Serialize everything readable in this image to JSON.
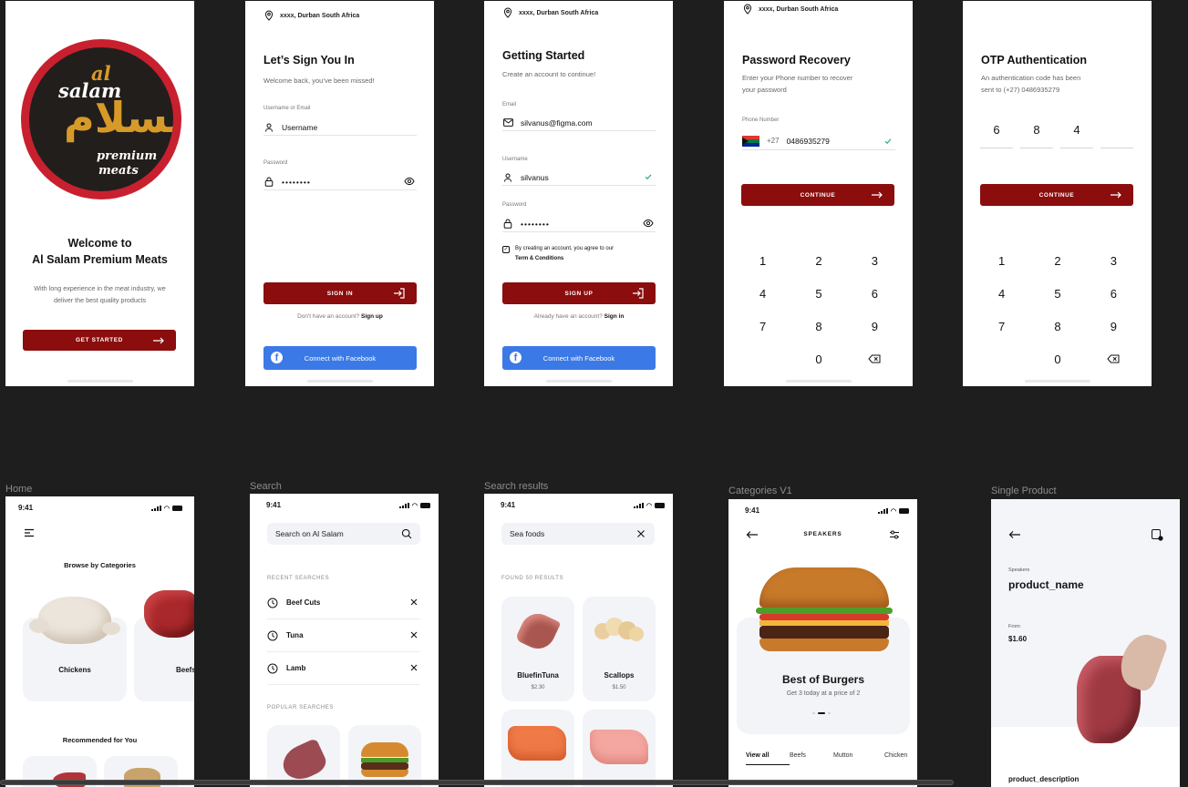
{
  "location": "xxxx, Durban South Africa",
  "welcome": {
    "logo_text": [
      "al",
      "salam",
      "السلام",
      "premium",
      "meats"
    ],
    "title_line1": "Welcome to",
    "title_line2": "Al Salam Premium Meats",
    "desc_line1": "With long experience in the meat industry, we",
    "desc_line2": "deliver the best quality products",
    "button": "GET STARTED"
  },
  "signin": {
    "title": "Let’s Sign You In",
    "subtitle": "Welcome back, you’ve been missed!",
    "username_label": "Username or Email",
    "username_value": "Username",
    "password_label": "Password",
    "password_value": "••••••••",
    "button": "SIGN IN",
    "alt_text": "Don't have an account?",
    "alt_link": "Sign up",
    "facebook": "Connect with Facebook"
  },
  "signup": {
    "title": "Getting Started",
    "subtitle": "Create an account to continue!",
    "email_label": "Email",
    "email_value": "silvanus@figma.com",
    "username_label": "Username",
    "username_value": "silvanus",
    "password_label": "Password",
    "password_value": "••••••••",
    "terms_line1": "By creating an account, you agree to our",
    "terms_line2": "Term & Conditions",
    "button": "SIGN UP",
    "alt_text": "Already have an account?",
    "alt_link": "Sign in",
    "facebook": "Connect with Facebook"
  },
  "recovery": {
    "title": "Password Recovery",
    "subtitle_line1": "Enter your Phone number to recover",
    "subtitle_line2": "your password",
    "phone_label": "Phone Number",
    "country_code": "+27",
    "phone_value": "0486935279",
    "button": "CONTINUE",
    "keys": [
      "1",
      "2",
      "3",
      "4",
      "5",
      "6",
      "7",
      "8",
      "9",
      "",
      "0",
      "⌫"
    ]
  },
  "otp": {
    "title": "OTP Authentication",
    "subtitle_line1": "An authentication code has been",
    "subtitle_line2": "sent to (+27) 0486935279",
    "digits": [
      "6",
      "8",
      "4",
      ""
    ],
    "button": "CONTINUE",
    "keys": [
      "1",
      "2",
      "3",
      "4",
      "5",
      "6",
      "7",
      "8",
      "9",
      "",
      "0",
      "⌫"
    ]
  },
  "labels": {
    "home": "Home",
    "search": "Search",
    "results": "Search results",
    "categories": "Categories V1",
    "product": "Single Product"
  },
  "time": "9:41",
  "home": {
    "browse": "Browse by Categories",
    "cat1": "Chickens",
    "cat2": "Beefs",
    "recommended": "Recommended for You"
  },
  "search": {
    "placeholder": "Search on Al Salam",
    "recent_label": "RECENT SEARCHES",
    "recent": [
      "Beef Cuts",
      "Tuna",
      "Lamb"
    ],
    "popular_label": "POPULAR SEARCHES"
  },
  "results": {
    "query": "Sea foods",
    "found": "FOUND 50 RESULTS",
    "items": [
      {
        "name": "BluefinTuna",
        "price": "$2.30"
      },
      {
        "name": "Scallops",
        "price": "$1.50"
      }
    ]
  },
  "categories": {
    "header": "SPEAKERS",
    "banner_title": "Best of Burgers",
    "banner_sub": "Get 3 today at a price of 2",
    "tabs": [
      "View all",
      "Beefs",
      "Mutton",
      "Chicken"
    ]
  },
  "product": {
    "category": "Speakers",
    "name": "product_name",
    "from_label": "From",
    "price": "$1.60",
    "description": "product_description"
  },
  "colors": {
    "brand_red": "#8b0d0d",
    "facebook_blue": "#3b79e6",
    "canvas": "#1e1e1e",
    "card": "#f2f4f8"
  }
}
